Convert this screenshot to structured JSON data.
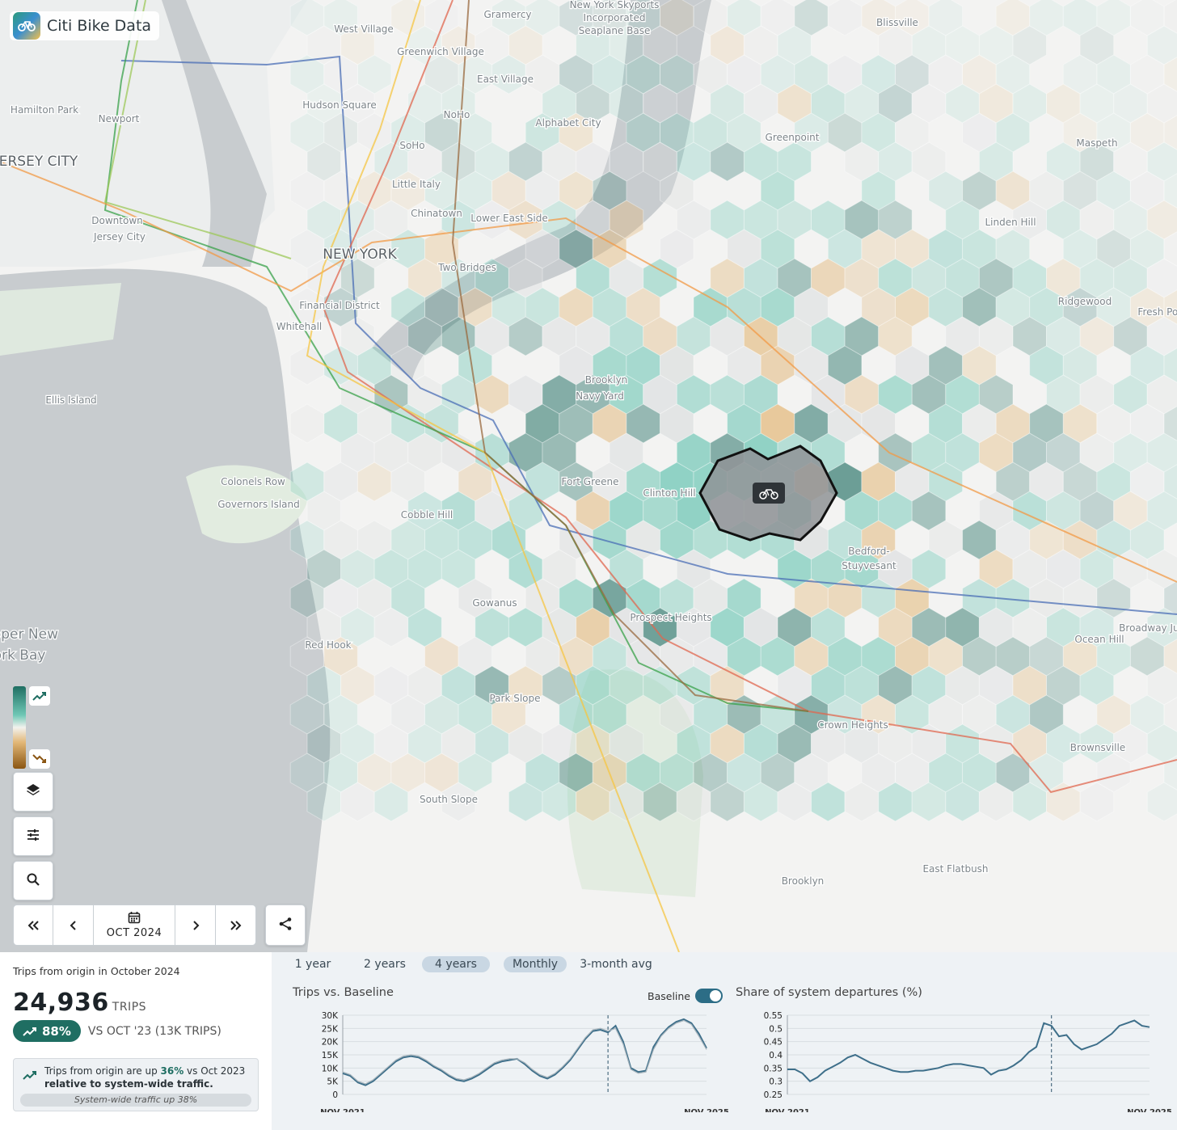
{
  "app": {
    "title": "Citi Bike Data",
    "logo_icon": "bike-icon"
  },
  "map": {
    "labels": [
      "Gramercy",
      "New York Skyports",
      "Incorporated",
      "Seaplane Base",
      "Blissville",
      "West Village",
      "Greenwich Village",
      "East Village",
      "Hamilton Park",
      "Newport",
      "Hudson Square",
      "NoHo",
      "Alphabet City",
      "SoHo",
      "Greenpoint",
      "Maspeth",
      "JERSEY CITY",
      "Little Italy",
      "Chinatown",
      "Lower East Side",
      "Downtown",
      "Jersey City",
      "Linden Hill",
      "NEW YORK",
      "Two Bridges",
      "Ridgewood",
      "Financial District",
      "Whitehall",
      "Brooklyn",
      "Navy Yard",
      "Ellis Island",
      "Colonels Row",
      "Governors Island",
      "Fort Greene",
      "Clinton Hill",
      "Cobble Hill",
      "Bedford-",
      "Stuyvesant",
      "Gowanus",
      "Prospect Heights",
      "Upper New",
      "York Bay",
      "Red Hook",
      "Ocean Hill",
      "Park Slope",
      "Crown Heights",
      "Brownsville",
      "South Slope",
      "East Flatbush",
      "Brooklyn",
      "Fresh Pond",
      "Broadway Junction"
    ],
    "selected_marker_icon": "bike-icon",
    "colors": {
      "up_strong": "#1f6e62",
      "up": "#6fc7b5",
      "down": "#e2b777",
      "neutral": "#d9dcdd"
    }
  },
  "legend": {
    "up_icon": "trending-up-icon",
    "down_icon": "trending-down-icon"
  },
  "controls": {
    "layers_icon": "layers-icon",
    "filters_icon": "sliders-icon",
    "search_icon": "search-icon",
    "share_icon": "share-icon",
    "date_label": "OCT 2024",
    "calendar_icon": "calendar-icon"
  },
  "stats": {
    "subtitle": "Trips from origin in October 2024",
    "trips": "24,936",
    "trips_unit": "TRIPS",
    "pct_change": "88%",
    "vs_text": "VS OCT '23 (13K TRIPS)",
    "note_prefix": "Trips from origin are up ",
    "note_pct": "36%",
    "note_mid": " vs Oct 2023",
    "note_line2": "relative to system-wide traffic.",
    "note_footer": "System-wide traffic up 38%"
  },
  "tabs": [
    {
      "label": "1 year",
      "active": false
    },
    {
      "label": "2 years",
      "active": false
    },
    {
      "label": "4 years",
      "active": true
    },
    {
      "label": "Monthly",
      "active": true
    },
    {
      "label": "3-month avg",
      "active": false
    }
  ],
  "baseline_toggle": {
    "label": "Baseline",
    "on": true
  },
  "chart_data": [
    {
      "type": "line",
      "title": "Trips vs. Baseline",
      "xlabel": "",
      "ylabel": "",
      "x_range_labels": [
        "NOV 2021",
        "NOV 2025"
      ],
      "yticks": [
        "30K",
        "25K",
        "20K",
        "15K",
        "10K",
        "5K",
        "0"
      ],
      "ylim": [
        0,
        30000
      ],
      "marker_month_index": 35,
      "series": [
        {
          "values": [
            8000,
            7000,
            4500,
            3500,
            5000,
            7500,
            10000,
            12500,
            14000,
            14500,
            14000,
            12500,
            10500,
            9000,
            7000,
            5500,
            5000,
            6000,
            7500,
            9500,
            11500,
            12500,
            13000,
            13500,
            11500,
            9000,
            7000,
            6000,
            7500,
            10000,
            13000,
            17000,
            21000,
            24000,
            24500,
            23500,
            26000,
            20000,
            10000,
            8500,
            9000,
            18000,
            22500,
            25500,
            27500,
            28500,
            27000,
            23000,
            17500
          ]
        },
        {
          "values": [
            8500,
            7500,
            5000,
            4000,
            5500,
            8000,
            10500,
            13000,
            14500,
            15000,
            14500,
            13000,
            11000,
            9500,
            7500,
            6000,
            5500,
            6500,
            8000,
            10000,
            12000,
            13000,
            13500,
            13500,
            12000,
            9500,
            7500,
            6500,
            8000,
            10500,
            13500,
            17500,
            21500,
            24500,
            25000,
            24000,
            25000,
            19000,
            9500,
            8000,
            8500,
            17000,
            22000,
            25000,
            27000,
            28000,
            26500,
            22000,
            17000
          ]
        }
      ]
    },
    {
      "type": "line",
      "title": "Share of system departures (%)",
      "xlabel": "",
      "ylabel": "",
      "x_range_labels": [
        "NOV 2021",
        "NOV 2025"
      ],
      "yticks": [
        "0.55",
        "0.5",
        "0.45",
        "0.4",
        "0.35",
        "0.3",
        "0.25"
      ],
      "ylim": [
        0.25,
        0.55
      ],
      "marker_month_index": 35,
      "series": [
        {
          "values": [
            0.345,
            0.345,
            0.33,
            0.3,
            0.315,
            0.34,
            0.355,
            0.37,
            0.39,
            0.4,
            0.385,
            0.37,
            0.36,
            0.35,
            0.34,
            0.335,
            0.335,
            0.34,
            0.34,
            0.345,
            0.35,
            0.36,
            0.365,
            0.365,
            0.36,
            0.355,
            0.35,
            0.325,
            0.34,
            0.345,
            0.36,
            0.38,
            0.41,
            0.43,
            0.52,
            0.51,
            0.47,
            0.475,
            0.44,
            0.42,
            0.43,
            0.44,
            0.46,
            0.48,
            0.51,
            0.52,
            0.53,
            0.51,
            0.505
          ]
        }
      ]
    }
  ]
}
